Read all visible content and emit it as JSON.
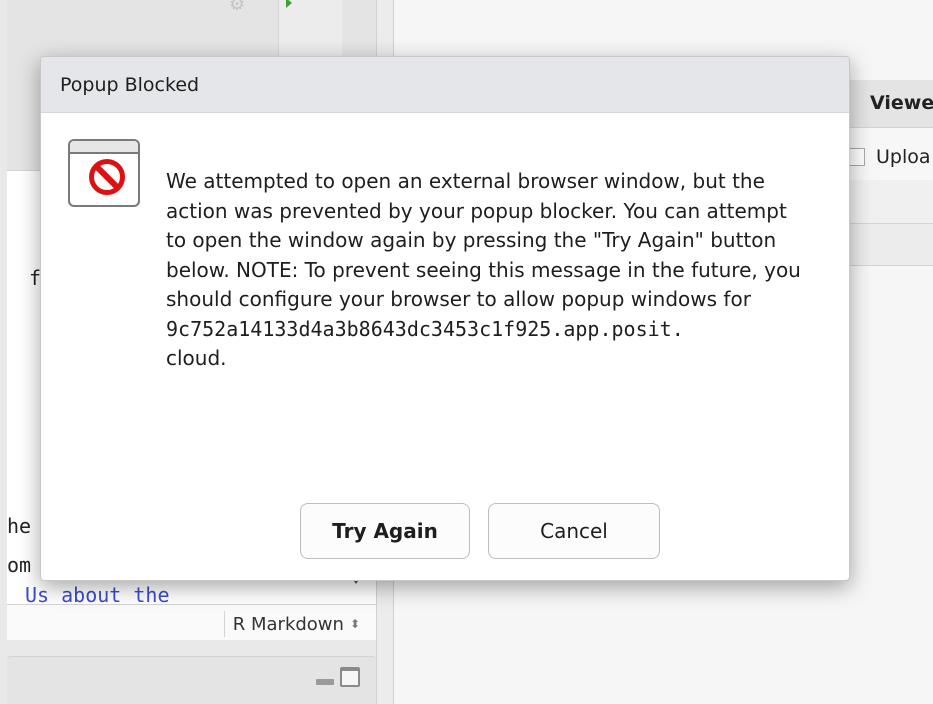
{
  "background": {
    "editor_fragments": [
      "f",
      "he",
      "om",
      "Us about the"
    ],
    "status_mode": "R Markdown",
    "right_tab_label": "Viewe",
    "right_toolbar_label": "Uploa"
  },
  "dialog": {
    "title": "Popup Blocked",
    "message_line_1": "We attempted to open an external browser window, but the action was prevented by your popup blocker. You can attempt to open the window again by pressing the \"Try Again\" button below. NOTE: To prevent seeing this message in the future, you should configure your browser to allow popup windows for",
    "host": "9c752a14133d4a3b8643dc3453c1f925.app.posit.",
    "host_tail": "cloud.",
    "primary_button": "Try Again",
    "secondary_button": "Cancel"
  },
  "colors": {
    "ban_red": "#dd1111",
    "titlebar": "#e4e6ea"
  }
}
